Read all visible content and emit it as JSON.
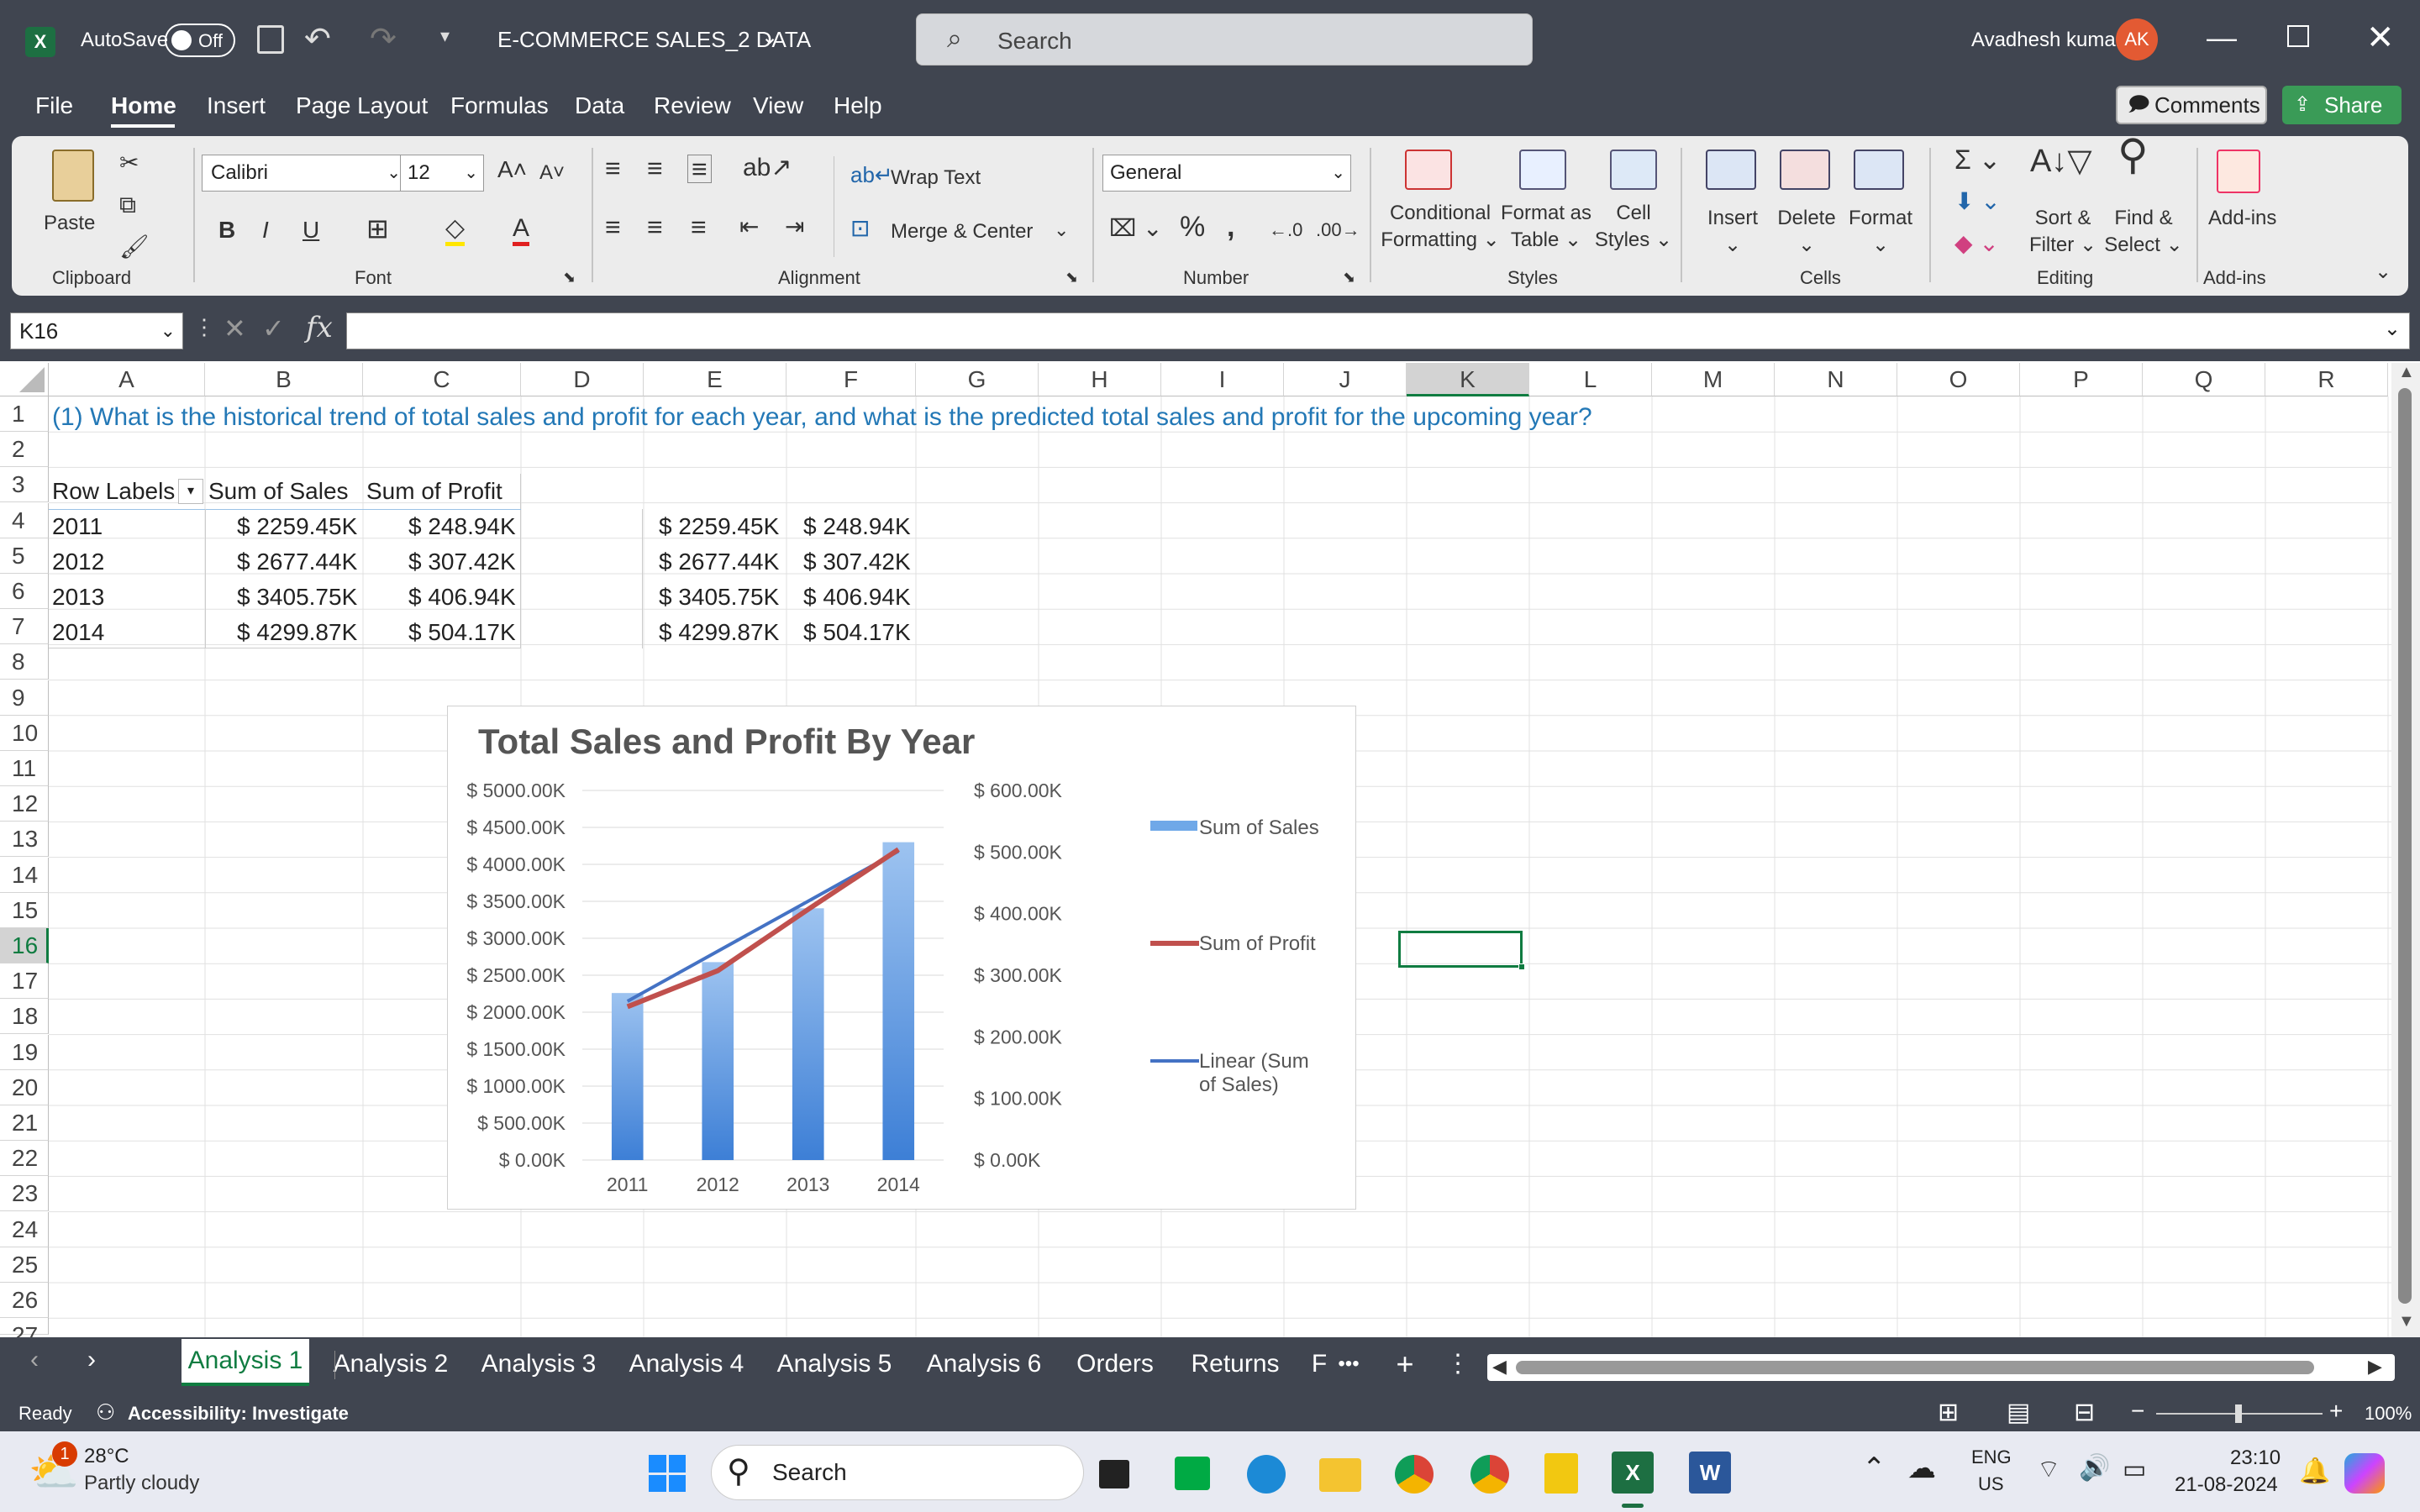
{
  "titlebar": {
    "autosave": "AutoSave",
    "toggle": "Off",
    "filename": "E-COMMERCE SALES_2 DATA",
    "search_placeholder": "Search",
    "user": "Avadhesh kumar",
    "initials": "AK"
  },
  "menu": {
    "items": [
      "File",
      "Home",
      "Insert",
      "Page Layout",
      "Formulas",
      "Data",
      "Review",
      "View",
      "Help"
    ],
    "comments": "Comments",
    "share": "Share"
  },
  "ribbon": {
    "paste": "Paste",
    "clipboard": "Clipboard",
    "font_name": "Calibri",
    "font_size": "12",
    "font": "Font",
    "wrap": "Wrap Text",
    "merge": "Merge & Center",
    "alignment": "Alignment",
    "number_format": "General",
    "number": "Number",
    "cond1": "Conditional",
    "cond2": "Formatting",
    "fmt1": "Format as",
    "fmt2": "Table",
    "cell1": "Cell",
    "cell2": "Styles",
    "styles": "Styles",
    "insert": "Insert",
    "delete": "Delete",
    "format": "Format",
    "cells": "Cells",
    "sort1": "Sort &",
    "sort2": "Filter",
    "find1": "Find &",
    "find2": "Select",
    "editing": "Editing",
    "addins": "Add-ins",
    "addins_group": "Add-ins"
  },
  "formula": {
    "namebox": "K16",
    "fx": "fx",
    "value": ""
  },
  "columns": [
    "A",
    "B",
    "C",
    "D",
    "E",
    "F",
    "G",
    "H",
    "I",
    "J",
    "K",
    "L",
    "M",
    "N",
    "O",
    "P",
    "Q",
    "R"
  ],
  "rows": [
    "1",
    "2",
    "3",
    "4",
    "5",
    "6",
    "7",
    "8",
    "9",
    "10",
    "11",
    "12",
    "13",
    "14",
    "15",
    "16",
    "17",
    "18",
    "19",
    "20",
    "21",
    "22",
    "23",
    "24",
    "25",
    "26",
    "27"
  ],
  "cells": {
    "question": "(1) What is the historical trend of total sales and profit for each year, and what is the predicted total sales and profit for the upcoming year?",
    "hdr_rows": "Row Labels",
    "hdr_sales": "Sum of Sales",
    "hdr_profit": "Sum of Profit",
    "years": [
      "2011",
      "2012",
      "2013",
      "2014"
    ],
    "sales": [
      "$ 2259.45K",
      "$ 2677.44K",
      "$ 3405.75K",
      "$ 4299.87K"
    ],
    "profit": [
      "$ 248.94K",
      "$ 307.42K",
      "$ 406.94K",
      "$ 504.17K"
    ]
  },
  "chart_data": {
    "type": "bar",
    "title": "Total Sales and Profit By Year",
    "categories": [
      "2011",
      "2012",
      "2013",
      "2014"
    ],
    "series": [
      {
        "name": "Sum of Sales",
        "type": "bar",
        "axis": "left",
        "values": [
          2259.45,
          2677.44,
          3405.75,
          4299.87
        ]
      },
      {
        "name": "Sum of Profit",
        "type": "line",
        "axis": "right",
        "values": [
          248.94,
          307.42,
          406.94,
          504.17
        ]
      },
      {
        "name": "Linear (Sum of Sales)",
        "type": "trendline",
        "axis": "left",
        "values": [
          2148.0,
          2825.0,
          3502.0,
          4179.0
        ]
      }
    ],
    "y_left": {
      "min": 0,
      "max": 5000,
      "ticks": [
        "$ 0.00K",
        "$ 500.00K",
        "$ 1000.00K",
        "$ 1500.00K",
        "$ 2000.00K",
        "$ 2500.00K",
        "$ 3000.00K",
        "$ 3500.00K",
        "$ 4000.00K",
        "$ 4500.00K",
        "$ 5000.00K"
      ]
    },
    "y_right": {
      "min": 0,
      "max": 600,
      "ticks": [
        "$ 0.00K",
        "$ 100.00K",
        "$ 200.00K",
        "$ 300.00K",
        "$ 400.00K",
        "$ 500.00K",
        "$ 600.00K"
      ]
    },
    "legend_position": "right",
    "colors": {
      "bar": "#5b9bd5",
      "profit": "#c0504d",
      "trend": "#4472c4"
    }
  },
  "tabs": [
    "Analysis 1",
    "Analysis 2",
    "Analysis 3",
    "Analysis 4",
    "Analysis 5",
    "Analysis 6",
    "Orders",
    "Returns",
    "F"
  ],
  "status": {
    "ready": "Ready",
    "accessibility": "Accessibility: Investigate",
    "zoom": "100%"
  },
  "taskbar": {
    "temp": "28°C",
    "weather": "Partly cloudy",
    "badge": "1",
    "search": "Search",
    "lang1": "ENG",
    "lang2": "US",
    "time": "23:10",
    "date": "21-08-2024"
  }
}
